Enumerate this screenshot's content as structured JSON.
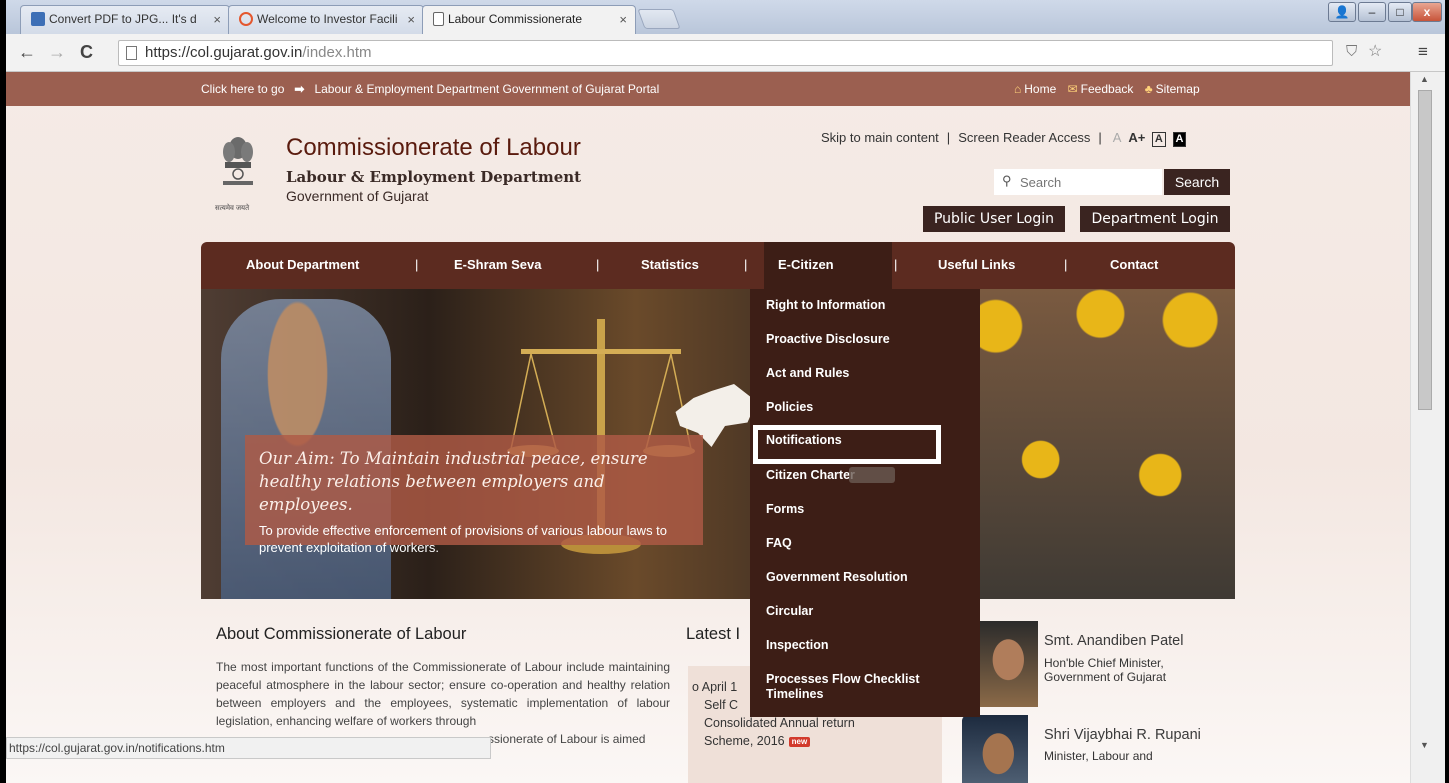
{
  "browser": {
    "tabs": [
      {
        "title": "Convert PDF to JPG... It's d",
        "close": "×",
        "icon_color": "#3d6fb6"
      },
      {
        "title": "Welcome to Investor Facili",
        "close": "×",
        "icon_color": "#e4572e"
      },
      {
        "title": "Labour Commissionerate",
        "close": "×",
        "icon_color": "#ffffff"
      }
    ],
    "url_host": "https://col.gujarat.gov.in",
    "url_path": "/index.htm",
    "status_url": "https://col.gujarat.gov.in/notifications.htm"
  },
  "topbar": {
    "click_here": "Click here to go",
    "portal_link": "Labour & Employment Department Government of Gujarat Portal",
    "home": "Home",
    "feedback": "Feedback",
    "sitemap": "Sitemap"
  },
  "header": {
    "title": "Commissionerate of Labour",
    "subtitle": "Labour & Employment Department",
    "subtitle2": "Government of Gujarat",
    "emblem_motto": "सत्यमेव जयते",
    "skip": "Skip to main content",
    "screen_reader": "Screen Reader Access",
    "font_small": "A",
    "font_large": "A+",
    "contrast_light": "A",
    "contrast_dark": "A",
    "search_placeholder": "Search",
    "search_button": "Search",
    "public_login": "Public User Login",
    "dept_login": "Department Login"
  },
  "nav": {
    "items": [
      "About Department",
      "E-Shram Seva",
      "Statistics",
      "E-Citizen",
      "Useful Links",
      "Contact"
    ],
    "separator": "|"
  },
  "dropdown": {
    "items": [
      "Right to Information",
      "Proactive Disclosure",
      "Act and Rules",
      "Policies",
      "Notifications",
      "Citizen Charter",
      "Forms",
      "FAQ",
      "Government Resolution",
      "Circular",
      "Inspection",
      "Processes Flow Checklist Timelines"
    ]
  },
  "banner": {
    "aim_title": "Our Aim: To Maintain industrial peace, ensure healthy relations between employers and employees.",
    "aim_text": "To provide effective enforcement of provisions of various labour laws to prevent exploitation of workers."
  },
  "about": {
    "heading": "About Commissionerate of Labour",
    "text": "The most important functions of the Commissionerate of Labour include maintaining peaceful atmosphere in the labour sector; ensure co-operation and healthy relation between employers and the employees, systematic implementation of labour legislation, enhancing welfare of workers through",
    "text_tail": "ssionerate of Labour is aimed"
  },
  "latest": {
    "heading": "Latest I",
    "line1": "o  April 1",
    "line2": "Self C",
    "line3": "Consolidated Annual return",
    "line4": "Scheme, 2016",
    "badge": "new"
  },
  "leaders": [
    {
      "name": "Smt. Anandiben Patel",
      "role_line1": "Hon'ble Chief Minister,",
      "role_line2": "Government of Gujarat"
    },
    {
      "name": "Shri Vijaybhai R. Rupani",
      "role_line1": "Minister, Labour and"
    }
  ],
  "colors": {
    "topstrip": "#9b5f50",
    "nav": "#5c2b20",
    "dropdown": "#3d1e16",
    "title": "#5a1b0e",
    "aim_box": "#af5a46"
  }
}
